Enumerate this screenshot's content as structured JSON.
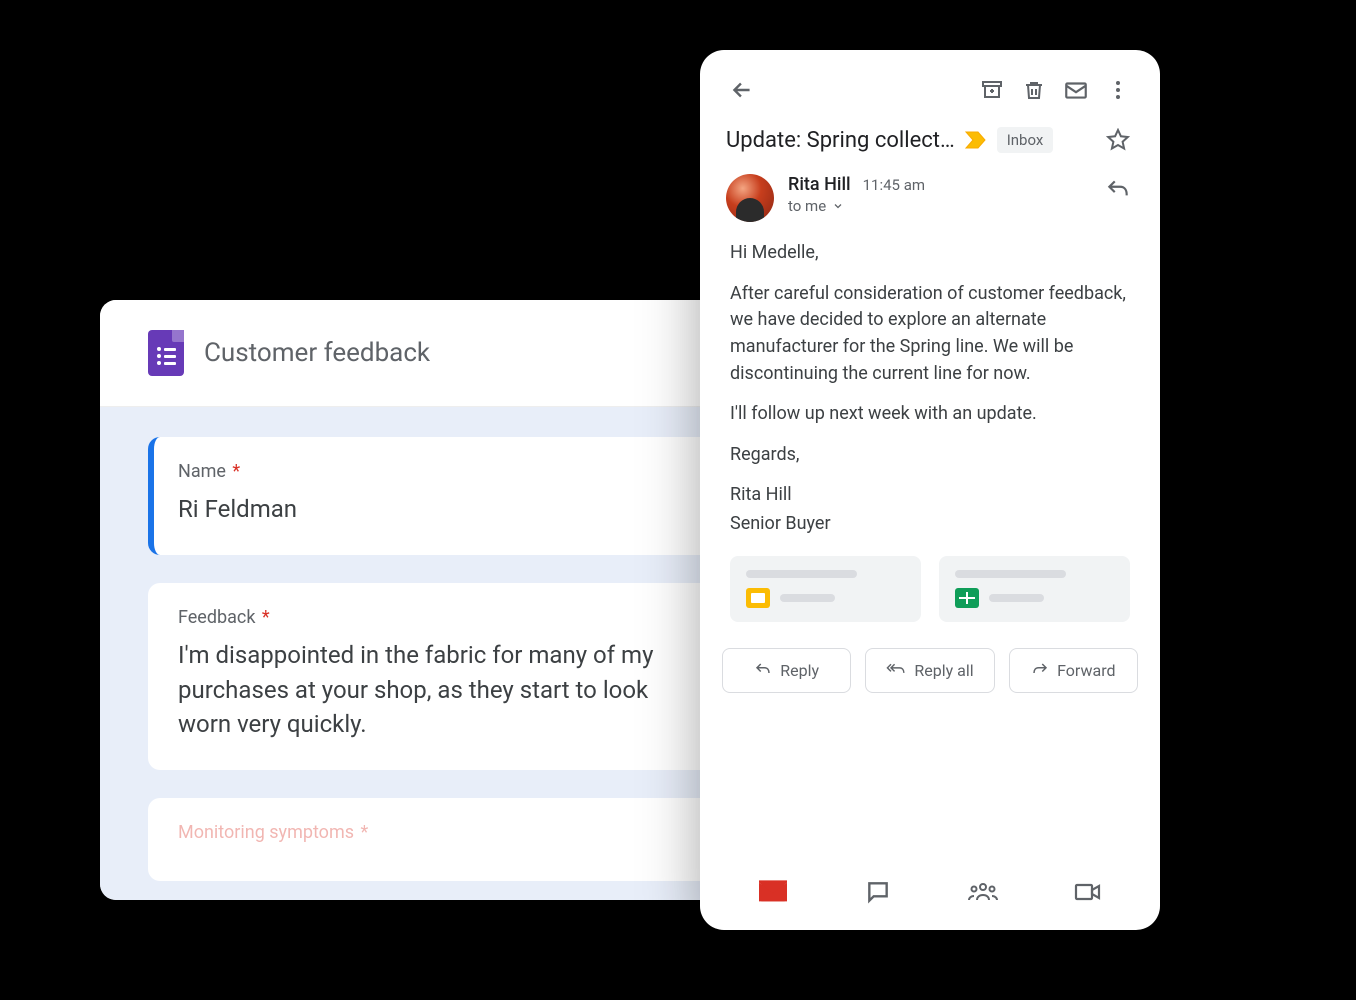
{
  "forms": {
    "title": "Customer feedback",
    "fields": [
      {
        "label": "Name",
        "required": true,
        "value": "Ri Feldman"
      },
      {
        "label": "Feedback",
        "required": true,
        "value": "I'm disappointed in the fabric for many of my purchases at your shop, as they start to look worn very quickly."
      },
      {
        "label": "Monitoring symptoms",
        "required": true,
        "value": ""
      }
    ]
  },
  "gmail": {
    "subject": "Update: Spring collect…",
    "inbox_tag": "Inbox",
    "sender": {
      "name": "Rita Hill",
      "time": "11:45 am",
      "to": "to me"
    },
    "body": {
      "greeting": "Hi Medelle,",
      "p1": "After careful consideration of customer feedback, we have decided to explore an alternate manufacturer for the Spring line. We will be discontinuing the current line for now.",
      "p2": "I'll follow up next week with an update.",
      "closing": "Regards,",
      "sig1": "Rita Hill",
      "sig2": "Senior Buyer"
    },
    "actions": {
      "reply": "Reply",
      "reply_all": "Reply all",
      "forward": "Forward"
    }
  }
}
